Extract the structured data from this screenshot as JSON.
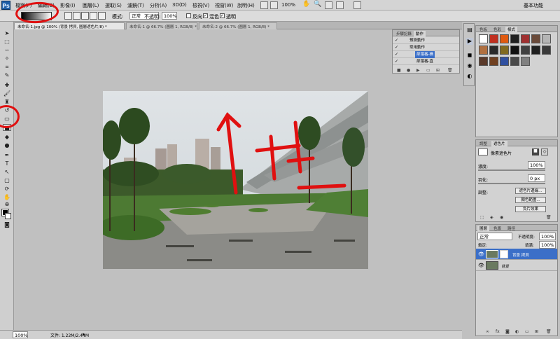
{
  "menubar": {
    "logo": "Ps",
    "items": [
      "檔案(F)",
      "編輯(E)",
      "影像(I)",
      "圖層(L)",
      "選取(S)",
      "濾鏡(T)",
      "分析(A)",
      "3D(D)",
      "檢視(V)",
      "視窗(W)",
      "說明(H)"
    ],
    "zoom": "100%",
    "workspace": "基本功能"
  },
  "options": {
    "mode_label": "模式:",
    "mode_value": "正常",
    "opacity_label": "不透明:",
    "opacity_value": "100%",
    "reverse_label": "反向",
    "dither_label": "混色",
    "transparency_label": "透明"
  },
  "tabs": [
    "未命名-1.jpg @ 100% (背景 拷貝, 圖層遮色片/8) *",
    "未命名-1 @ 66.7% (圖層 1, RGB/8) *",
    "未命名-2 @ 66.7% (圖層 1, RGB/8) *"
  ],
  "actions_panel": {
    "tabs": [
      "步驟記錄",
      "動作"
    ],
    "rows": [
      {
        "label": "預設動作",
        "selected": false
      },
      {
        "label": "常用動作",
        "selected": false
      },
      {
        "label": "部落格-橫",
        "selected": true
      },
      {
        "label": "部落格-直",
        "selected": false
      }
    ]
  },
  "styles_panel": {
    "tabs": [
      "色板",
      "色彩",
      "樣式"
    ],
    "swatch_colors": [
      "#ffffff",
      "#c03020",
      "#e05a10",
      "#202020",
      "#a03030",
      "#6a4a3a",
      "#b5b5b5",
      "#b07040",
      "#2a2a2a",
      "#806a20",
      "#111111",
      "#404040",
      "#202020",
      "#3a3a3a",
      "#5a3a2a",
      "#704020",
      "#3050a0",
      "#4a4a4a",
      "#808080"
    ]
  },
  "adjust_panel": {
    "tabs": [
      "調整",
      "遮色片"
    ],
    "mask_label": "像素遮色片",
    "density_label": "濃度:",
    "density_value": "100%",
    "feather_label": "羽化:",
    "feather_value": "0 px",
    "refine_label": "調整:",
    "buttons": [
      "遮色片邊緣...",
      "顏色範圍...",
      "負片效果"
    ]
  },
  "layers_panel": {
    "tabs": [
      "圖層",
      "色版",
      "路徑"
    ],
    "blend": "正常",
    "opacity_label": "不透明度:",
    "opacity_value": "100%",
    "lock_label": "鎖定:",
    "fill_label": "填滿:",
    "fill_value": "100%",
    "layers": [
      {
        "name": "背景 拷貝",
        "selected": true
      },
      {
        "name": "背景",
        "selected": false
      }
    ]
  },
  "status": {
    "zoom": "100%",
    "doc_info": "文件: 1.22M/2.44M"
  },
  "colors": {
    "selection": "#3b6fc8",
    "annotation": "#e01010"
  }
}
